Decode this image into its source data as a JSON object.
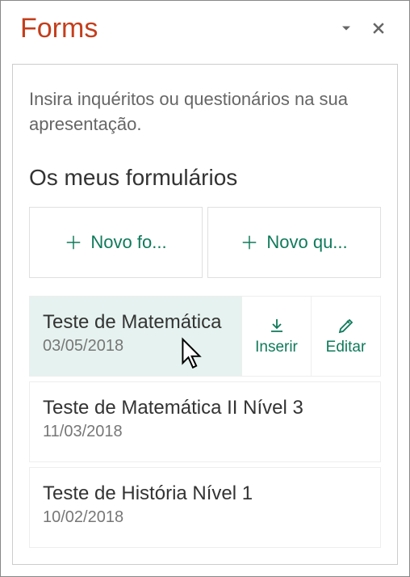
{
  "panel": {
    "title": "Forms",
    "intro": "Insira inquéritos ou questionários na sua apresentação.",
    "section_title": "Os meus formulários"
  },
  "new_buttons": {
    "new_form": "Novo fo...",
    "new_quiz": "Novo qu..."
  },
  "actions": {
    "insert": "Inserir",
    "edit": "Editar"
  },
  "forms": [
    {
      "title": "Teste de Matemática",
      "date": "03/05/2018",
      "selected": true
    },
    {
      "title": "Teste de Matemática II Nível 3",
      "date": "11/03/2018",
      "selected": false
    },
    {
      "title": "Teste de História Nível 1",
      "date": "10/02/2018",
      "selected": false
    }
  ]
}
